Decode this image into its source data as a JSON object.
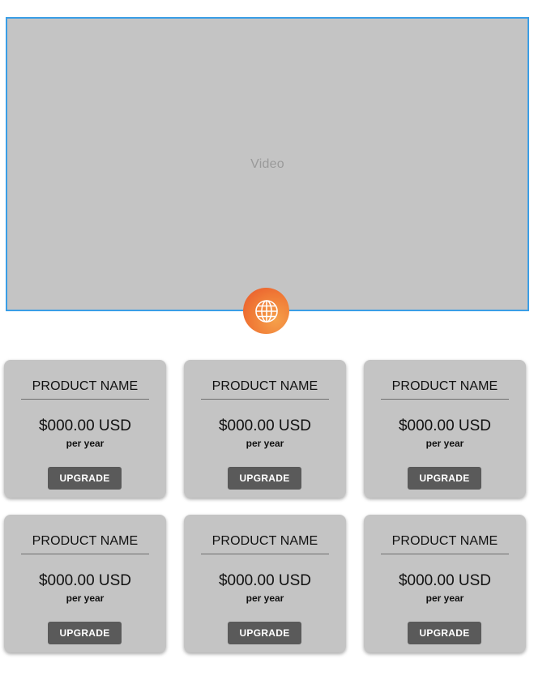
{
  "video": {
    "label": "Video"
  },
  "globe_button": {
    "icon": "globe-icon",
    "colors": [
      "#e8552b",
      "#f5a04a"
    ]
  },
  "products": [
    {
      "name": "PRODUCT NAME",
      "price": "$000.00 USD",
      "period": "per year",
      "button": "UPGRADE"
    },
    {
      "name": "PRODUCT NAME",
      "price": "$000.00 USD",
      "period": "per year",
      "button": "UPGRADE"
    },
    {
      "name": "PRODUCT NAME",
      "price": "$000.00 USD",
      "period": "per year",
      "button": "UPGRADE"
    },
    {
      "name": "PRODUCT NAME",
      "price": "$000.00 USD",
      "period": "per year",
      "button": "UPGRADE"
    },
    {
      "name": "PRODUCT NAME",
      "price": "$000.00 USD",
      "period": "per year",
      "button": "UPGRADE"
    },
    {
      "name": "PRODUCT NAME",
      "price": "$000.00 USD",
      "period": "per year",
      "button": "UPGRADE"
    }
  ],
  "colors": {
    "video_border": "#3a9ee6",
    "card_background": "#c4c4c4",
    "button_background": "#5a5a5a"
  }
}
